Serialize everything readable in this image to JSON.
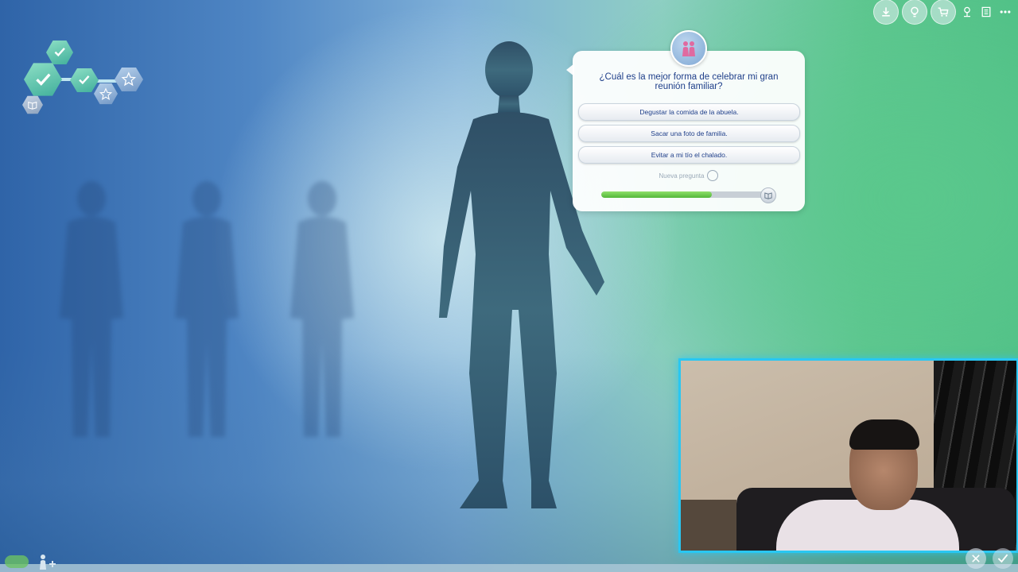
{
  "question_panel": {
    "question": "¿Cuál es la mejor forma de celebrar mi gran reunión familiar?",
    "answers": [
      "Degustar la comida de la abuela.",
      "Sacar una foto de familia.",
      "Evitar a mi tío el chalado."
    ],
    "new_question_label": "Nueva pregunta",
    "progress": 0.66,
    "icon": "family-icon"
  },
  "progress_map": {
    "completed_steps": 3,
    "remaining_steps": 2,
    "icons": [
      "check-icon",
      "check-icon",
      "check-icon",
      "star-icon",
      "star-icon",
      "book-icon"
    ]
  },
  "toolbar": {
    "icons": [
      "download-icon",
      "lightbulb-icon",
      "cart-icon",
      "gallery-icon",
      "list-icon",
      "more-icon"
    ]
  },
  "bottom": {
    "icons": [
      "add-sim-icon",
      "close-icon",
      "accept-icon"
    ]
  },
  "colors": {
    "panel_text": "#1f3f8a",
    "progress_fill": "#54b83a",
    "webcam_border": "#29c7f2"
  }
}
